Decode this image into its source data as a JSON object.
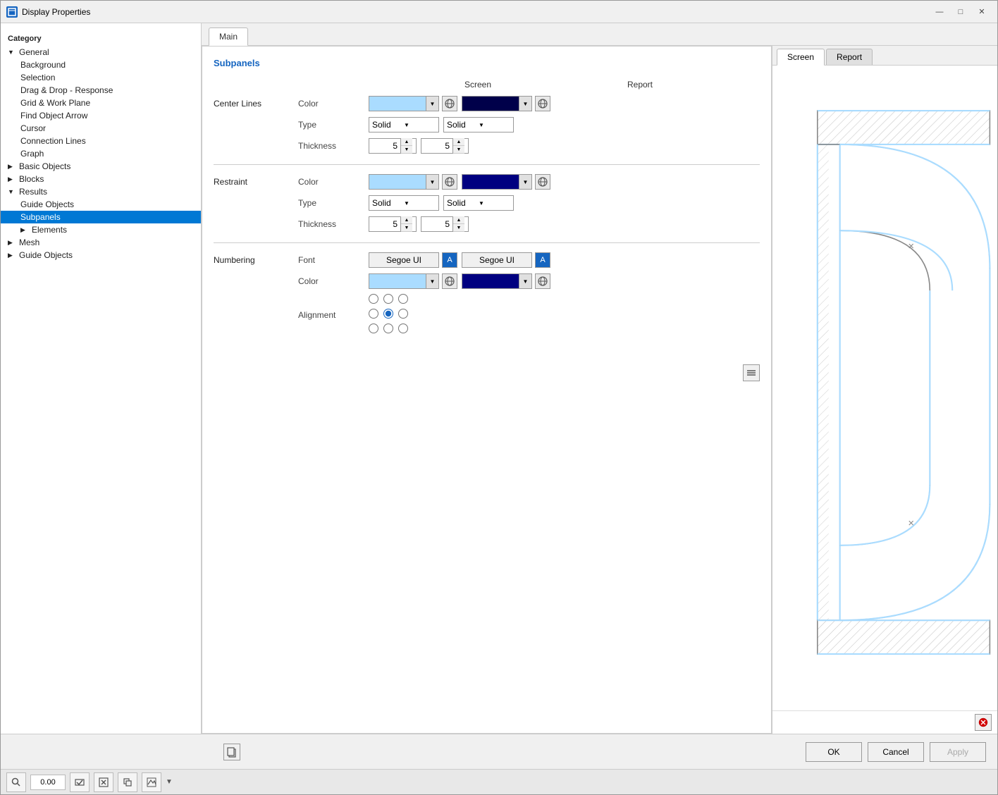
{
  "window": {
    "title": "Display Properties",
    "icon": "D"
  },
  "titlebar_controls": {
    "minimize": "—",
    "maximize": "□",
    "close": "✕"
  },
  "sidebar": {
    "category_label": "Category",
    "items": [
      {
        "id": "general",
        "label": "General",
        "level": 0,
        "expandable": true,
        "expanded": true
      },
      {
        "id": "background",
        "label": "Background",
        "level": 1
      },
      {
        "id": "selection",
        "label": "Selection",
        "level": 1
      },
      {
        "id": "drag-drop",
        "label": "Drag & Drop - Response",
        "level": 1
      },
      {
        "id": "grid-work-plane",
        "label": "Grid & Work Plane",
        "level": 1
      },
      {
        "id": "find-object-arrow",
        "label": "Find Object Arrow",
        "level": 1
      },
      {
        "id": "cursor",
        "label": "Cursor",
        "level": 1
      },
      {
        "id": "connection-lines",
        "label": "Connection Lines",
        "level": 1
      },
      {
        "id": "graph",
        "label": "Graph",
        "level": 1
      },
      {
        "id": "basic-objects",
        "label": "Basic Objects",
        "level": 0,
        "expandable": true,
        "expanded": false
      },
      {
        "id": "blocks",
        "label": "Blocks",
        "level": 0,
        "expandable": true,
        "expanded": false
      },
      {
        "id": "results",
        "label": "Results",
        "level": 0,
        "expandable": true,
        "expanded": true
      },
      {
        "id": "guide-objects-r",
        "label": "Guide Objects",
        "level": 1
      },
      {
        "id": "subpanels",
        "label": "Subpanels",
        "level": 1,
        "selected": true
      },
      {
        "id": "elements",
        "label": "Elements",
        "level": 1,
        "expandable": true,
        "expanded": false
      },
      {
        "id": "mesh",
        "label": "Mesh",
        "level": 0,
        "expandable": true,
        "expanded": false
      },
      {
        "id": "guide-objects-top",
        "label": "Guide Objects",
        "level": 0,
        "expandable": true,
        "expanded": false
      }
    ]
  },
  "main_tab": {
    "label": "Main"
  },
  "subpanels_section": {
    "label": "Subpanels"
  },
  "col_headers": {
    "screen": "Screen",
    "report": "Report"
  },
  "preview_tabs": {
    "screen": "Screen",
    "report": "Report"
  },
  "center_lines": {
    "label": "Center Lines",
    "color_attr": "Color",
    "type_attr": "Type",
    "thickness_attr": "Thickness",
    "screen_color": "#aadcff",
    "screen_type": "Solid",
    "screen_thickness": "5",
    "report_color": "#00004a",
    "report_type": "Solid",
    "report_thickness": "5"
  },
  "restraint": {
    "label": "Restraint",
    "color_attr": "Color",
    "type_attr": "Type",
    "thickness_attr": "Thickness",
    "screen_color": "#aadcff",
    "screen_type": "Solid",
    "screen_thickness": "5",
    "report_color": "#000080",
    "report_type": "Solid",
    "report_thickness": "5"
  },
  "numbering": {
    "label": "Numbering",
    "font_attr": "Font",
    "color_attr": "Color",
    "alignment_attr": "Alignment",
    "screen_font": "Segoe UI",
    "screen_color": "#aadcff",
    "report_font": "Segoe UI",
    "report_color": "#000080",
    "alignment_selected": 4
  },
  "footer_buttons": {
    "ok": "OK",
    "cancel": "Cancel",
    "apply": "Apply"
  },
  "taskbar": {
    "coord_value": "0.00"
  }
}
